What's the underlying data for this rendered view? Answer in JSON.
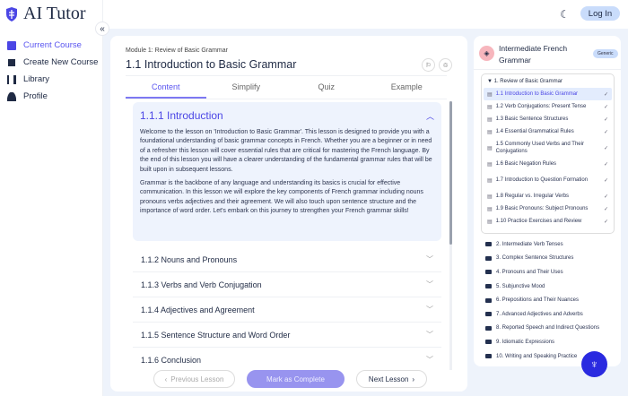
{
  "app": {
    "name": "AI Tutor",
    "login": "Log In"
  },
  "sidebar": {
    "items": [
      {
        "label": "Current Course"
      },
      {
        "label": "Create New Course"
      },
      {
        "label": "Library"
      },
      {
        "label": "Profile"
      }
    ]
  },
  "lesson": {
    "module": "Module 1: Review of Basic Grammar",
    "title": "1.1 Introduction to Basic Grammar",
    "tabs": [
      "Content",
      "Simplify",
      "Quiz",
      "Example"
    ],
    "open_section": {
      "title": "1.1.1 Introduction",
      "paragraphs": [
        "Welcome to the lesson on 'Introduction to Basic Grammar'. This lesson is designed to provide you with a foundational understanding of basic grammar concepts in French. Whether you are a beginner or in need of a refresher this lesson will cover essential rules that are critical for mastering the French language. By the end of this lesson you will have a clearer understanding of the fundamental grammar rules that will be built upon in subsequent lessons.",
        "Grammar is the backbone of any language and understanding its basics is crucial for effective communication. In this lesson we will explore the key components of French grammar including nouns pronouns verbs adjectives and their agreement. We will also touch upon sentence structure and the importance of word order. Let's embark on this journey to strengthen your French grammar skills!"
      ]
    },
    "sections": [
      "1.1.2 Nouns and Pronouns",
      "1.1.3 Verbs and Verb Conjugation",
      "1.1.4 Adjectives and Agreement",
      "1.1.5 Sentence Structure and Word Order",
      "1.1.6 Conclusion"
    ],
    "prev": "Previous Lesson",
    "complete": "Mark as Complete",
    "next": "Next Lesson"
  },
  "course": {
    "title": "Intermediate French Grammar",
    "badge": "Generic",
    "module1": "1. Review of Basic Grammar",
    "lessons": [
      "1.1 Introduction to Basic Grammar",
      "1.2 Verb Conjugations: Present Tense",
      "1.3 Basic Sentence Structures",
      "1.4 Essential Grammatical Rules",
      "1.5 Commonly Used Verbs and Their Conjugations",
      "1.6 Basic Negation Rules",
      "1.7 Introduction to Question Formation",
      "1.8 Regular vs. Irregular Verbs",
      "1.9 Basic Pronouns: Subject Pronouns",
      "1.10 Practice Exercises and Review"
    ],
    "modules": [
      "2. Intermediate Verb Tenses",
      "3. Complex Sentence Structures",
      "4. Pronouns and Their Uses",
      "5. Subjunctive Mood",
      "6. Prepositions and Their Nuances",
      "7. Advanced Adjectives and Adverbs",
      "8. Reported Speech and Indirect Questions",
      "9. Idiomatic Expressions",
      "10. Writing and Speaking Practice"
    ]
  },
  "colors": {
    "accent": "#5a55f0",
    "fab": "#2a2ae0",
    "login": "#c9dcfb"
  }
}
